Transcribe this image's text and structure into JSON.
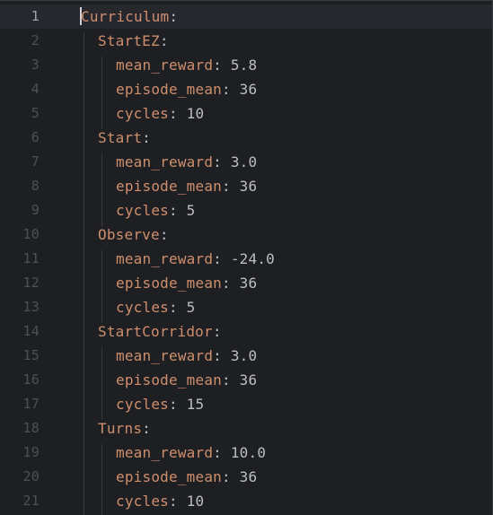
{
  "editor": {
    "lines": [
      {
        "num": "1",
        "key": "Curriculum",
        "colon": ":",
        "value": ""
      },
      {
        "num": "2",
        "key": "StartEZ",
        "colon": ":",
        "value": ""
      },
      {
        "num": "3",
        "key": "mean_reward",
        "colon": ":",
        "value": " 5.8"
      },
      {
        "num": "4",
        "key": "episode_mean",
        "colon": ":",
        "value": " 36"
      },
      {
        "num": "5",
        "key": "cycles",
        "colon": ":",
        "value": " 10"
      },
      {
        "num": "6",
        "key": "Start",
        "colon": ":",
        "value": ""
      },
      {
        "num": "7",
        "key": "mean_reward",
        "colon": ":",
        "value": " 3.0"
      },
      {
        "num": "8",
        "key": "episode_mean",
        "colon": ":",
        "value": " 36"
      },
      {
        "num": "9",
        "key": "cycles",
        "colon": ":",
        "value": " 5"
      },
      {
        "num": "10",
        "key": "Observe",
        "colon": ":",
        "value": ""
      },
      {
        "num": "11",
        "key": "mean_reward",
        "colon": ":",
        "value": " -24.0"
      },
      {
        "num": "12",
        "key": "episode_mean",
        "colon": ":",
        "value": " 36"
      },
      {
        "num": "13",
        "key": "cycles",
        "colon": ":",
        "value": " 5"
      },
      {
        "num": "14",
        "key": "StartCorridor",
        "colon": ":",
        "value": ""
      },
      {
        "num": "15",
        "key": "mean_reward",
        "colon": ":",
        "value": " 3.0"
      },
      {
        "num": "16",
        "key": "episode_mean",
        "colon": ":",
        "value": " 36"
      },
      {
        "num": "17",
        "key": "cycles",
        "colon": ":",
        "value": " 15"
      },
      {
        "num": "18",
        "key": "Turns",
        "colon": ":",
        "value": ""
      },
      {
        "num": "19",
        "key": "mean_reward",
        "colon": ":",
        "value": " 10.0"
      },
      {
        "num": "20",
        "key": "episode_mean",
        "colon": ":",
        "value": " 36"
      },
      {
        "num": "21",
        "key": "cycles",
        "colon": ":",
        "value": " 10"
      }
    ]
  },
  "colors": {
    "background": "#1e1f22",
    "current_line": "#26282e",
    "yaml_key": "#cf8e6d",
    "text": "#bcbec4",
    "line_number": "#4b5059"
  }
}
